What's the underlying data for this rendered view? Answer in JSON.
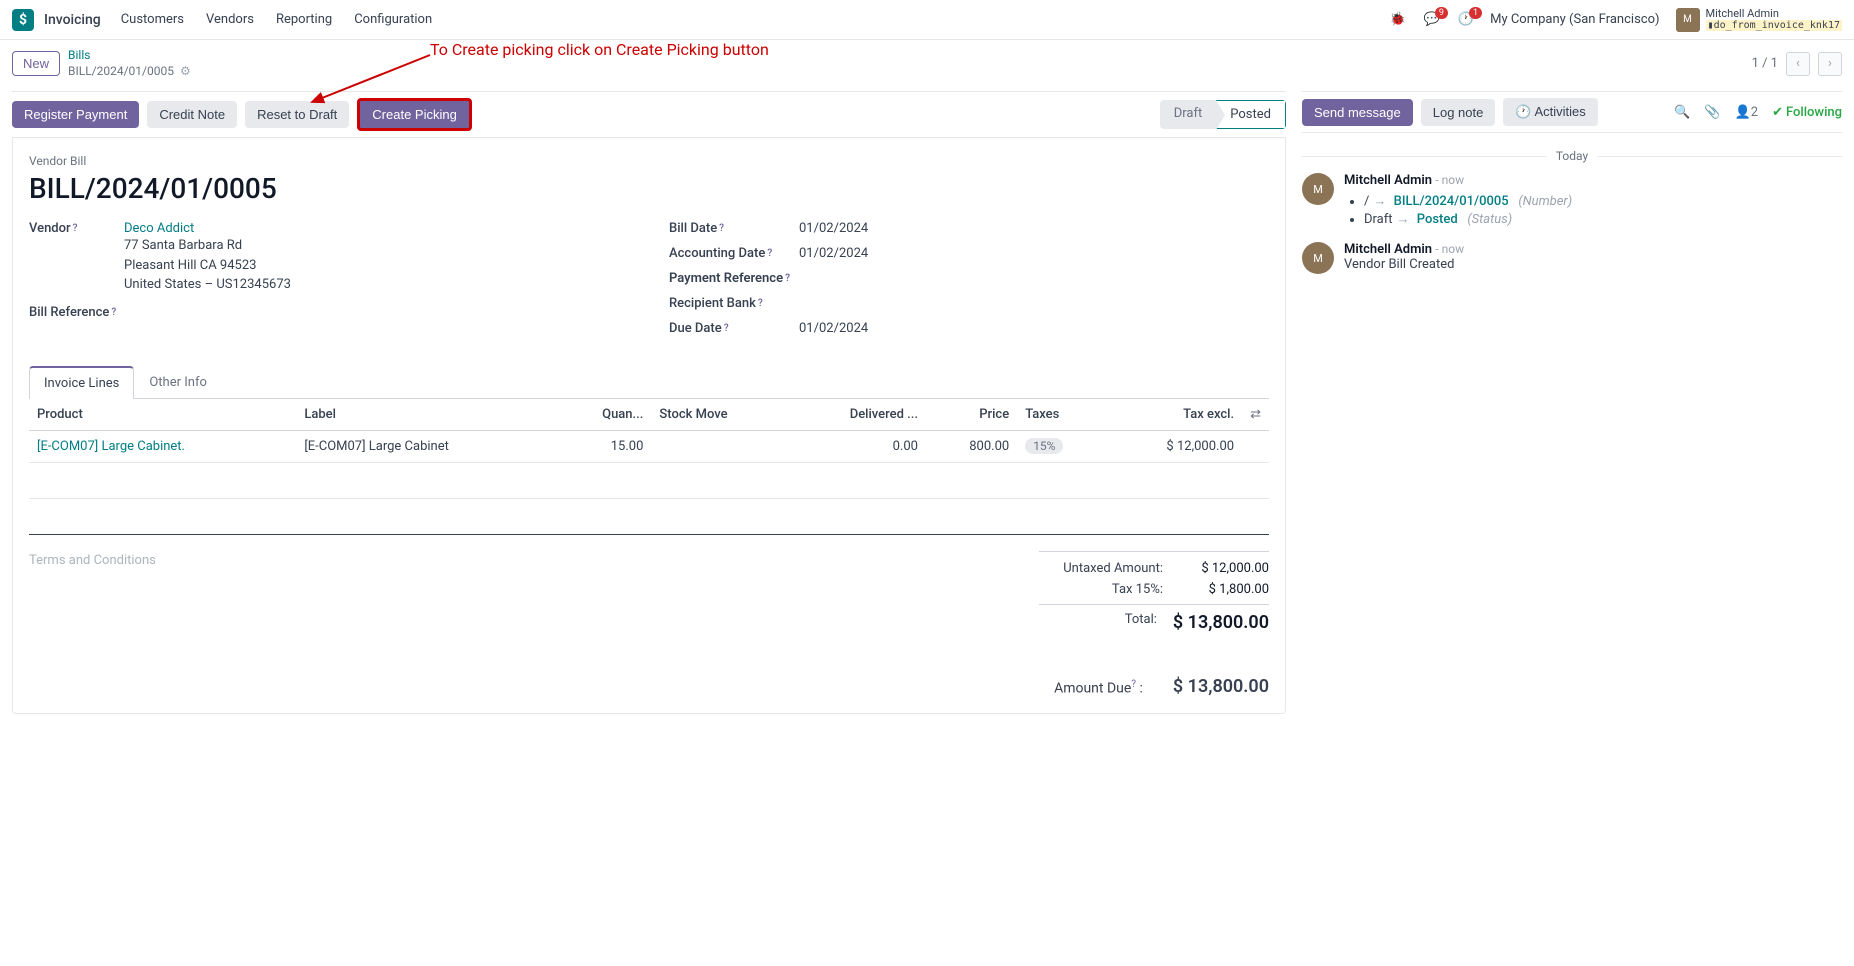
{
  "nav": {
    "app_title": "Invoicing",
    "items": [
      "Customers",
      "Vendors",
      "Reporting",
      "Configuration"
    ],
    "chat_badge": "9",
    "clock_badge": "1",
    "company": "My Company (San Francisco)",
    "user_name": "Mitchell Admin",
    "user_badge": "do_from_invoice_knk17"
  },
  "annotation": "To Create picking click on Create Picking button",
  "breadcrumb": {
    "new_btn": "New",
    "parent": "Bills",
    "current": "BILL/2024/01/0005",
    "pager": "1 / 1"
  },
  "actions": {
    "register_payment": "Register Payment",
    "credit_note": "Credit Note",
    "reset_draft": "Reset to Draft",
    "create_picking": "Create Picking",
    "status_draft": "Draft",
    "status_posted": "Posted"
  },
  "form": {
    "heading_label": "Vendor Bill",
    "title": "BILL/2024/01/0005",
    "vendor_label": "Vendor",
    "vendor_name": "Deco Addict",
    "vendor_addr1": "77 Santa Barbara Rd",
    "vendor_addr2": "Pleasant Hill CA 94523",
    "vendor_addr3": "United States – US12345673",
    "bill_ref_label": "Bill Reference",
    "bill_date_label": "Bill Date",
    "bill_date": "01/02/2024",
    "acc_date_label": "Accounting Date",
    "acc_date": "01/02/2024",
    "pay_ref_label": "Payment Reference",
    "rec_bank_label": "Recipient Bank",
    "due_date_label": "Due Date",
    "due_date": "01/02/2024"
  },
  "tabs": {
    "lines": "Invoice Lines",
    "other": "Other Info"
  },
  "table": {
    "h_product": "Product",
    "h_label": "Label",
    "h_qty": "Quan...",
    "h_stock": "Stock Move",
    "h_delivered": "Delivered ...",
    "h_price": "Price",
    "h_taxes": "Taxes",
    "h_taxexcl": "Tax excl.",
    "row": {
      "product": "[E-COM07] Large Cabinet.",
      "label": "[E-COM07] Large Cabinet",
      "qty": "15.00",
      "delivered": "0.00",
      "price": "800.00",
      "tax": "15%",
      "taxexcl": "$ 12,000.00"
    }
  },
  "terms_placeholder": "Terms and Conditions",
  "totals": {
    "untaxed_label": "Untaxed Amount:",
    "untaxed": "$ 12,000.00",
    "tax_label": "Tax 15%:",
    "tax": "$ 1,800.00",
    "total_label": "Total:",
    "total": "$ 13,800.00",
    "due_label": "Amount Due",
    "due": "$ 13,800.00"
  },
  "chatter": {
    "send": "Send message",
    "log": "Log note",
    "activities": "Activities",
    "followers": "2",
    "following": "Following",
    "today": "Today",
    "m1_author": "Mitchell Admin",
    "m1_time": "now",
    "m1_l1_prefix": "/",
    "m1_l1_link": "BILL/2024/01/0005",
    "m1_l1_field": "(Number)",
    "m1_l2_old": "Draft",
    "m1_l2_new": "Posted",
    "m1_l2_field": "(Status)",
    "m2_author": "Mitchell Admin",
    "m2_time": "now",
    "m2_body": "Vendor Bill Created"
  }
}
